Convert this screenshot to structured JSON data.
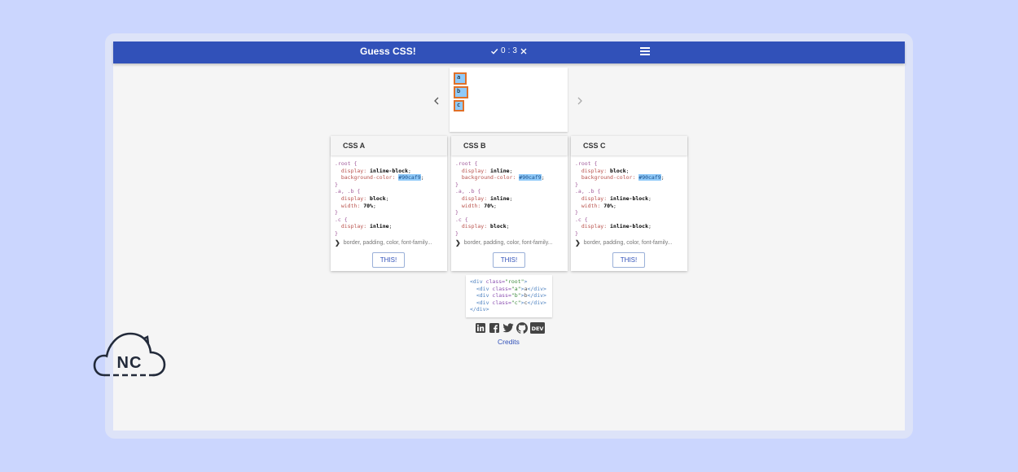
{
  "header": {
    "title": "Guess CSS!",
    "score_correct": "0",
    "score_sep": ":",
    "score_wrong": "3"
  },
  "preview": {
    "boxes": [
      "a",
      "b",
      "c"
    ]
  },
  "cards": [
    {
      "label": "CSS A",
      "lines": [
        {
          "sel": ".root {"
        },
        {
          "prop": "  display: ",
          "val": "inline-block",
          "end": ";"
        },
        {
          "prop": "  background-color: ",
          "hl": "#90caf9",
          "end": ";"
        },
        {
          "sel": "}"
        },
        {
          "sel": ".a, .b {"
        },
        {
          "prop": "  display: ",
          "val": "block",
          "end": ";"
        },
        {
          "prop": "  width: ",
          "val": "70%",
          "end": ";"
        },
        {
          "sel": "}"
        },
        {
          "sel": ".c {"
        },
        {
          "prop": "  display: ",
          "val": "inline",
          "end": ";"
        },
        {
          "sel": "}"
        }
      ],
      "more": "border, padding, color, font-family...",
      "button": "THIS!"
    },
    {
      "label": "CSS B",
      "lines": [
        {
          "sel": ".root {"
        },
        {
          "prop": "  display: ",
          "val": "inline",
          "end": ";"
        },
        {
          "prop": "  background-color: ",
          "hl": "#90caf9",
          "end": ";"
        },
        {
          "sel": "}"
        },
        {
          "sel": ".a, .b {"
        },
        {
          "prop": "  display: ",
          "val": "inline",
          "end": ";"
        },
        {
          "prop": "  width: ",
          "val": "70%",
          "end": ";"
        },
        {
          "sel": "}"
        },
        {
          "sel": ".c {"
        },
        {
          "prop": "  display: ",
          "val": "block",
          "end": ";"
        },
        {
          "sel": "}"
        }
      ],
      "more": "border, padding, color, font-family...",
      "button": "THIS!"
    },
    {
      "label": "CSS C",
      "lines": [
        {
          "sel": ".root {"
        },
        {
          "prop": "  display: ",
          "val": "block",
          "end": ";"
        },
        {
          "prop": "  background-color: ",
          "hl": "#90caf9",
          "end": ";"
        },
        {
          "sel": "}"
        },
        {
          "sel": ".a, .b {"
        },
        {
          "prop": "  display: ",
          "val": "inline-block",
          "end": ";"
        },
        {
          "prop": "  width: ",
          "val": "70%",
          "end": ";"
        },
        {
          "sel": "}"
        },
        {
          "sel": ".c {"
        },
        {
          "prop": "  display: ",
          "val": "inline-block",
          "end": ";"
        },
        {
          "sel": "}"
        }
      ],
      "more": "border, padding, color, font-family...",
      "button": "THIS!"
    }
  ],
  "html_snippet": [
    {
      "indent": "",
      "open": "<div ",
      "attr": "class=",
      "str": "\"root\"",
      "close": ">",
      "text": ""
    },
    {
      "indent": "  ",
      "open": "<div ",
      "attr": "class=",
      "str": "\"a\"",
      "close": ">",
      "text": "a",
      "end": "</div>"
    },
    {
      "indent": "  ",
      "open": "<div ",
      "attr": "class=",
      "str": "\"b\"",
      "close": ">",
      "text": "b",
      "end": "</div>"
    },
    {
      "indent": "  ",
      "open": "<div ",
      "attr": "class=",
      "str": "\"c\"",
      "close": ">",
      "text": "c",
      "end": "</div>"
    },
    {
      "indent": "",
      "open": "</div>",
      "attr": "",
      "str": "",
      "close": "",
      "text": ""
    }
  ],
  "social": [
    "linkedin-icon",
    "facebook-icon",
    "twitter-icon",
    "github-icon",
    "dev-icon"
  ],
  "dev_label": "DEV",
  "credits": "Credits",
  "logo_text": "NC",
  "colors": {
    "accent": "#3151b9",
    "highlight": "#90caf9",
    "box_border": "#e07028"
  }
}
